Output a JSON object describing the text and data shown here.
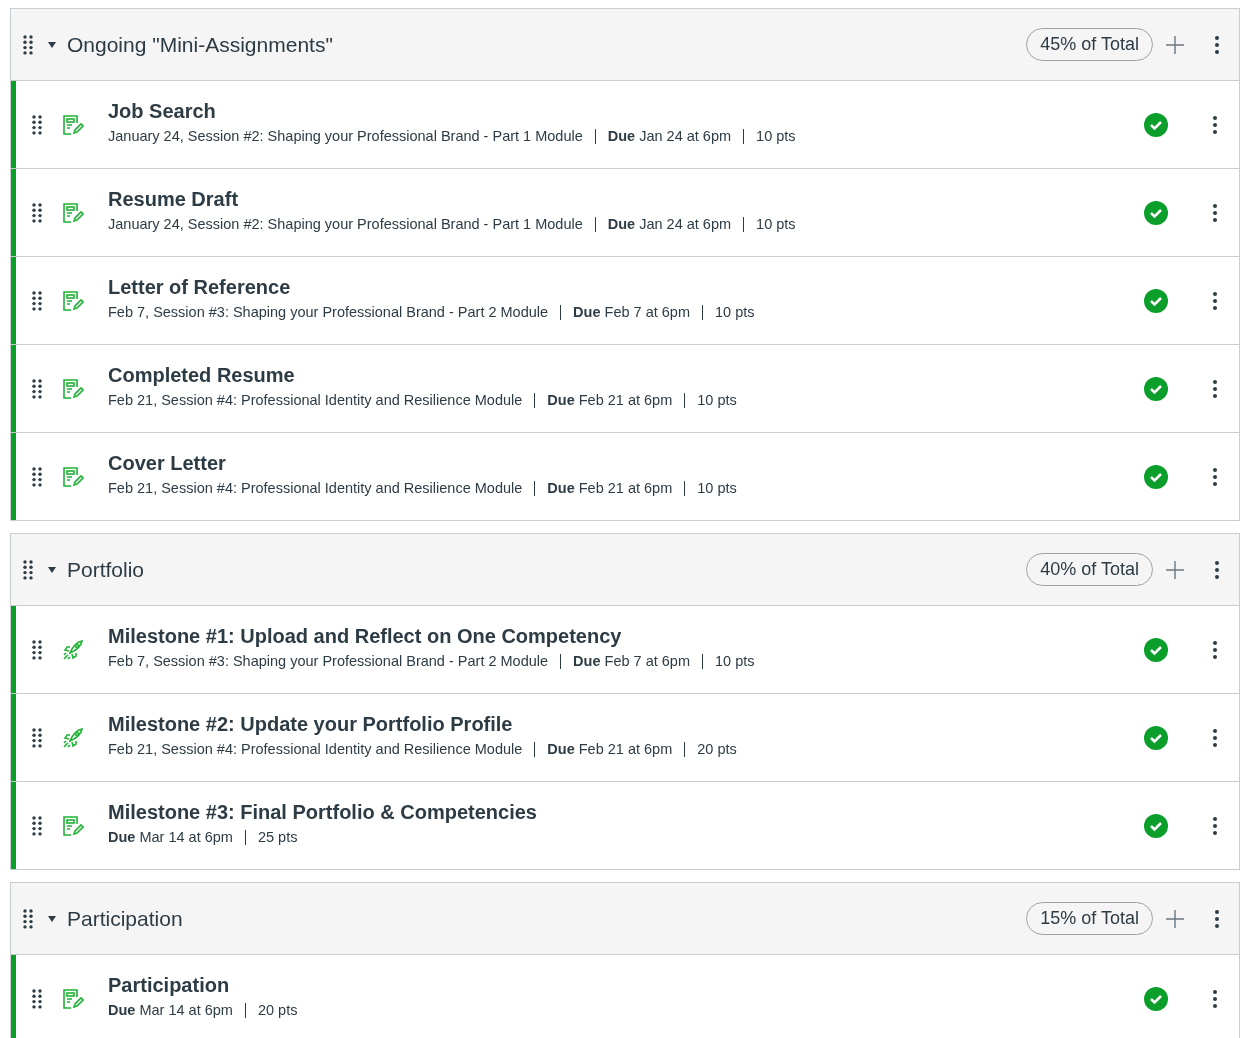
{
  "groups": [
    {
      "title": "Ongoing \"Mini-Assignments\"",
      "expanded": true,
      "weight": "45% of Total",
      "items": [
        {
          "kind": "assignment",
          "title": "Job Search",
          "published": true,
          "module": "January 24, Session #2: Shaping your Professional Brand - Part 1 Module",
          "due": "**Due** Jan 24 at 6pm",
          "points": "10 pts"
        },
        {
          "kind": "assignment",
          "title": "Resume Draft",
          "published": true,
          "module": "January 24, Session #2: Shaping your Professional Brand - Part 1 Module",
          "due": "**Due** Jan 24 at 6pm",
          "points": "10 pts"
        },
        {
          "kind": "assignment",
          "title": "Letter of Reference",
          "published": true,
          "module": "Feb 7, Session #3: Shaping your Professional Brand - Part 2 Module",
          "due": "**Due** Feb 7 at 6pm",
          "points": "10 pts"
        },
        {
          "kind": "assignment",
          "title": "Completed Resume",
          "published": true,
          "module": "Feb 21, Session #4: Professional Identity and Resilience Module",
          "due": "**Due** Feb 21 at 6pm",
          "points": "10 pts"
        },
        {
          "kind": "assignment",
          "title": "Cover Letter",
          "published": true,
          "module": "Feb 21, Session #4: Professional Identity and Resilience Module",
          "due": "**Due** Feb 21 at 6pm",
          "points": "10 pts"
        }
      ]
    },
    {
      "title": "Portfolio",
      "expanded": true,
      "weight": "40% of Total",
      "items": [
        {
          "kind": "rocket",
          "title": "Milestone #1: Upload and Reflect on One Competency",
          "published": true,
          "module": "Feb 7, Session #3: Shaping your Professional Brand - Part 2 Module",
          "due": "**Due** Feb 7 at 6pm",
          "points": "10 pts"
        },
        {
          "kind": "rocket",
          "title": "Milestone #2: Update your Portfolio Profile",
          "published": true,
          "module": "Feb 21, Session #4: Professional Identity and Resilience Module",
          "due": "**Due** Feb 21 at 6pm",
          "points": "20 pts"
        },
        {
          "kind": "assignment",
          "title": "Milestone #3: Final Portfolio & Competencies",
          "published": true,
          "due": "**Due** Mar 14 at 6pm",
          "points": "25 pts"
        }
      ]
    },
    {
      "title": "Participation",
      "expanded": true,
      "weight": "15% of Total",
      "items": [
        {
          "kind": "assignment",
          "title": "Participation",
          "published": true,
          "due": "**Due** Mar 14 at 6pm",
          "points": "20 pts"
        }
      ]
    }
  ]
}
